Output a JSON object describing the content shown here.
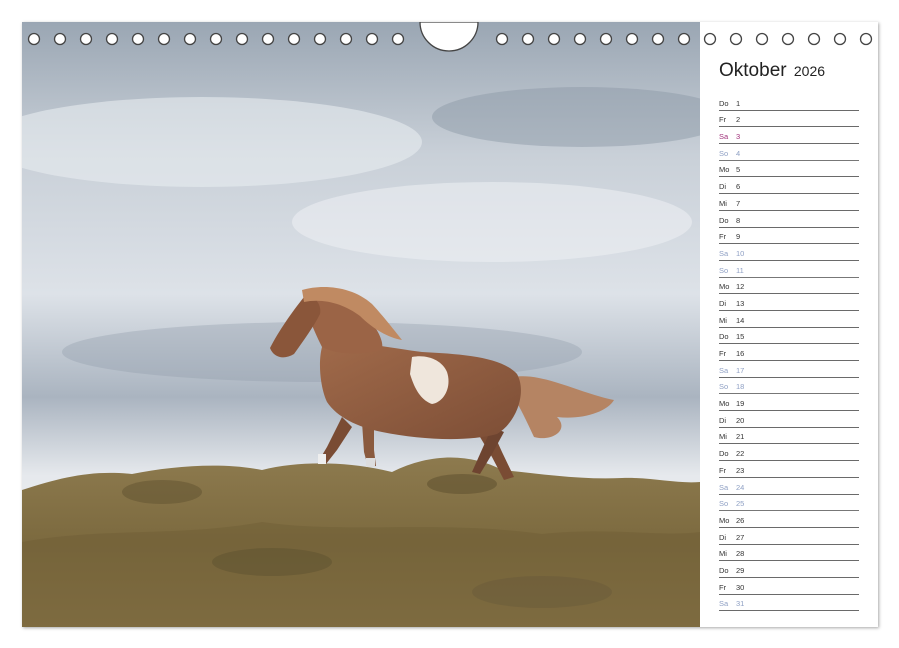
{
  "calendar": {
    "month": "Oktober",
    "year": "2026",
    "days": [
      {
        "wd": "Do",
        "d": "1",
        "type": "weekday"
      },
      {
        "wd": "Fr",
        "d": "2",
        "type": "weekday"
      },
      {
        "wd": "Sa",
        "d": "3",
        "type": "holiday"
      },
      {
        "wd": "So",
        "d": "4",
        "type": "sun"
      },
      {
        "wd": "Mo",
        "d": "5",
        "type": "weekday"
      },
      {
        "wd": "Di",
        "d": "6",
        "type": "weekday"
      },
      {
        "wd": "Mi",
        "d": "7",
        "type": "weekday"
      },
      {
        "wd": "Do",
        "d": "8",
        "type": "weekday"
      },
      {
        "wd": "Fr",
        "d": "9",
        "type": "weekday"
      },
      {
        "wd": "Sa",
        "d": "10",
        "type": "sat"
      },
      {
        "wd": "So",
        "d": "11",
        "type": "sun"
      },
      {
        "wd": "Mo",
        "d": "12",
        "type": "weekday"
      },
      {
        "wd": "Di",
        "d": "13",
        "type": "weekday"
      },
      {
        "wd": "Mi",
        "d": "14",
        "type": "weekday"
      },
      {
        "wd": "Do",
        "d": "15",
        "type": "weekday"
      },
      {
        "wd": "Fr",
        "d": "16",
        "type": "weekday"
      },
      {
        "wd": "Sa",
        "d": "17",
        "type": "sat"
      },
      {
        "wd": "So",
        "d": "18",
        "type": "sun"
      },
      {
        "wd": "Mo",
        "d": "19",
        "type": "weekday"
      },
      {
        "wd": "Di",
        "d": "20",
        "type": "weekday"
      },
      {
        "wd": "Mi",
        "d": "21",
        "type": "weekday"
      },
      {
        "wd": "Do",
        "d": "22",
        "type": "weekday"
      },
      {
        "wd": "Fr",
        "d": "23",
        "type": "weekday"
      },
      {
        "wd": "Sa",
        "d": "24",
        "type": "sat"
      },
      {
        "wd": "So",
        "d": "25",
        "type": "sun"
      },
      {
        "wd": "Mo",
        "d": "26",
        "type": "weekday"
      },
      {
        "wd": "Di",
        "d": "27",
        "type": "weekday"
      },
      {
        "wd": "Mi",
        "d": "28",
        "type": "weekday"
      },
      {
        "wd": "Do",
        "d": "29",
        "type": "weekday"
      },
      {
        "wd": "Fr",
        "d": "30",
        "type": "weekday"
      },
      {
        "wd": "Sa",
        "d": "31",
        "type": "sat"
      }
    ]
  },
  "photo": {
    "subject": "pinto-horse-icon",
    "colors": {
      "sky_light": "#dfe4ea",
      "sky_dark": "#8c98a6",
      "grass": "#8a7446",
      "horse": "#9a6446"
    }
  }
}
